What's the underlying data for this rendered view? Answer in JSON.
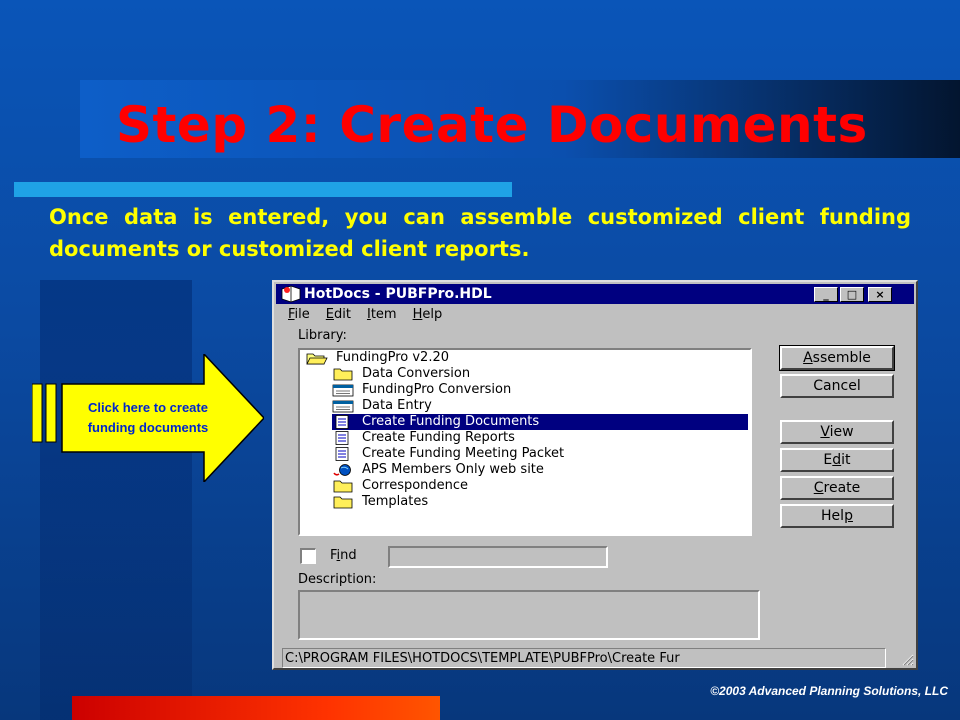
{
  "slide": {
    "title": "Step 2: Create Documents",
    "intro": "Once data is entered, you can assemble customized client funding documents or customized client reports.",
    "callout": "Click here to create funding documents",
    "copyright": "©2003 Advanced Planning Solutions, LLC"
  },
  "colors": {
    "title": "#ff0000",
    "intro": "#ffff00",
    "accent_bar": "#1fa2e6",
    "callout_fill": "#ffff00"
  },
  "dialog": {
    "title": "HotDocs - PUBFPro.HDL",
    "controls": {
      "minimize": "_",
      "maximize": "□",
      "close": "×"
    },
    "menu": [
      {
        "key": "F",
        "rest": "ile"
      },
      {
        "key": "E",
        "rest": "dit"
      },
      {
        "key": "I",
        "rest": "tem"
      },
      {
        "key": "H",
        "rest": "elp"
      }
    ],
    "library_label": "Library:",
    "library_items": [
      {
        "label": "FundingPro v2.20",
        "icon": "open-folder-icon",
        "indent": 0,
        "selected": false
      },
      {
        "label": "Data Conversion",
        "icon": "folder-icon",
        "indent": 1,
        "selected": false
      },
      {
        "label": "FundingPro Conversion",
        "icon": "form-icon",
        "indent": 1,
        "selected": false
      },
      {
        "label": "Data Entry",
        "icon": "form-icon",
        "indent": 1,
        "selected": false
      },
      {
        "label": "Create Funding Documents",
        "icon": "document-icon",
        "indent": 1,
        "selected": true
      },
      {
        "label": "Create Funding Reports",
        "icon": "document-icon",
        "indent": 1,
        "selected": false
      },
      {
        "label": "Create Funding Meeting Packet",
        "icon": "document-icon",
        "indent": 1,
        "selected": false
      },
      {
        "label": "APS Members Only web site",
        "icon": "web-link-icon",
        "indent": 1,
        "selected": false
      },
      {
        "label": "Correspondence",
        "icon": "folder-icon",
        "indent": 1,
        "selected": false
      },
      {
        "label": "Templates",
        "icon": "folder-icon",
        "indent": 1,
        "selected": false
      }
    ],
    "buttons": {
      "assemble": {
        "key": "A",
        "rest": "ssemble"
      },
      "cancel": "Cancel",
      "view": {
        "key": "V",
        "rest": "iew"
      },
      "edit": {
        "pre": "E",
        "key": "d",
        "rest": "it"
      },
      "create": {
        "key": "C",
        "rest": "reate"
      },
      "help": {
        "pre": "Hel",
        "key": "p",
        "rest": ""
      }
    },
    "find": {
      "pre": "F",
      "key": "i",
      "rest": "nd",
      "value": "",
      "checked": false
    },
    "description_label": "Description:",
    "description_value": "",
    "status_path": "C:\\PROGRAM FILES\\HOTDOCS\\TEMPLATE\\PUBFPro\\Create Fur"
  }
}
